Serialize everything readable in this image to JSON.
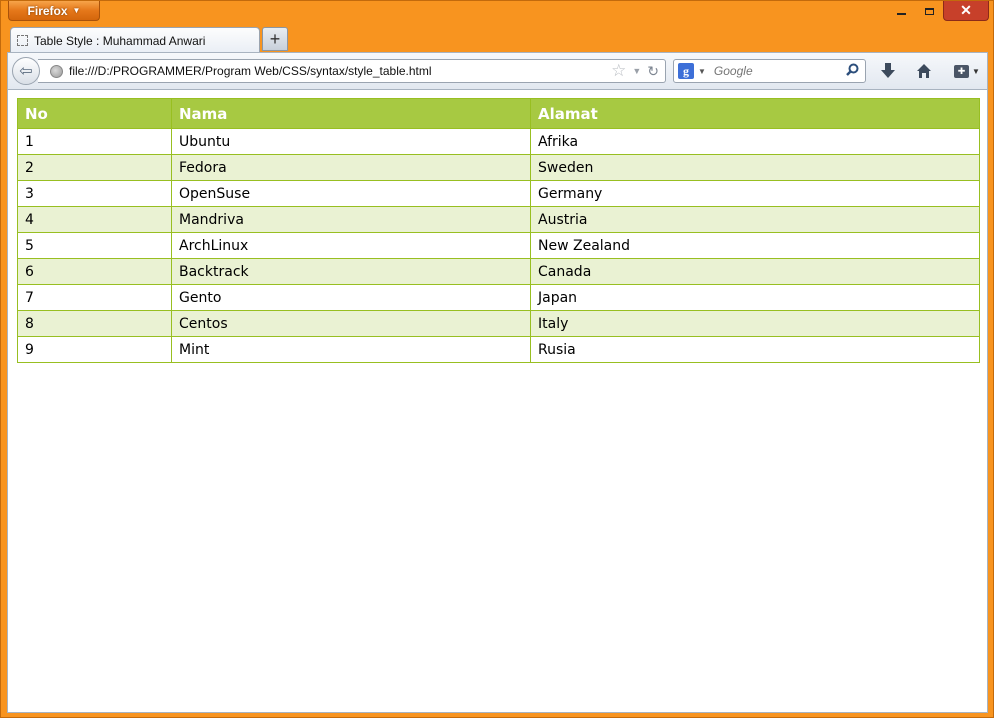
{
  "firefox_button": {
    "label": "Firefox"
  },
  "window_controls": {
    "close_label": "✕"
  },
  "tab": {
    "title": "Table Style : Muhammad Anwari"
  },
  "new_tab": {
    "label": "+"
  },
  "url": {
    "value": "file:///D:/PROGRAMMER/Program Web/CSS/syntax/style_table.html"
  },
  "search": {
    "engine_letter": "g",
    "placeholder": "Google"
  },
  "table": {
    "headers": [
      "No",
      "Nama",
      "Alamat"
    ],
    "rows": [
      [
        "1",
        "Ubuntu",
        "Afrika"
      ],
      [
        "2",
        "Fedora",
        "Sweden"
      ],
      [
        "3",
        "OpenSuse",
        "Germany"
      ],
      [
        "4",
        "Mandriva",
        "Austria"
      ],
      [
        "5",
        "ArchLinux",
        "New Zealand"
      ],
      [
        "6",
        "Backtrack",
        "Canada"
      ],
      [
        "7",
        "Gento",
        "Japan"
      ],
      [
        "8",
        "Centos",
        "Italy"
      ],
      [
        "9",
        "Mint",
        "Rusia"
      ]
    ],
    "header_color": "#a7c942",
    "alt_row_color": "#eaf2d3",
    "border_color": "#98bf21"
  },
  "colors": {
    "window_frame": "#f8941f"
  }
}
